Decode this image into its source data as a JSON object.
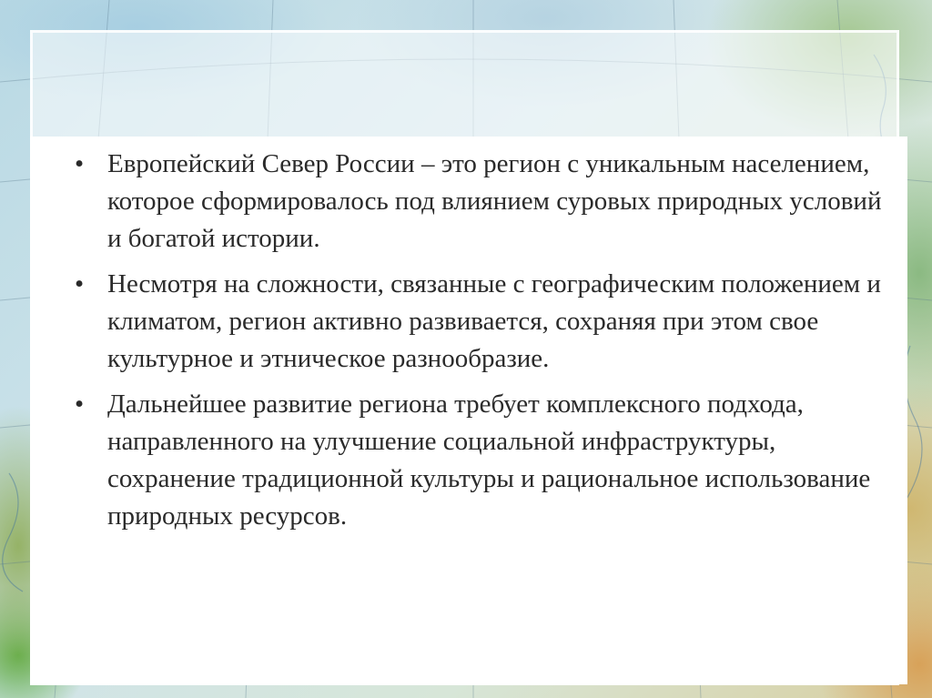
{
  "slide": {
    "bullet_symbol": "•",
    "bullets": [
      {
        "text": "Европейский Север России – это регион с уникальным населением, которое сформировалось под влиянием суровых природных условий и богатой истории."
      },
      {
        "text": "Несмотря на сложности, связанные с географическим положением и климатом, регион активно развивается, сохраняя при этом свое культурное и этническое разнообразие."
      },
      {
        "text": "Дальнейшее развитие региона требует комплексного подхода, направленного на улучшение социальной инфраструктуры, сохранение традиционной культуры и рациональное использование природных ресурсов."
      }
    ]
  },
  "theme": {
    "text_color": "#2a2a2a",
    "panel_color": "#ffffff",
    "map_water_color": "#b9d9e4",
    "map_land_color": "#d9cfa0"
  }
}
